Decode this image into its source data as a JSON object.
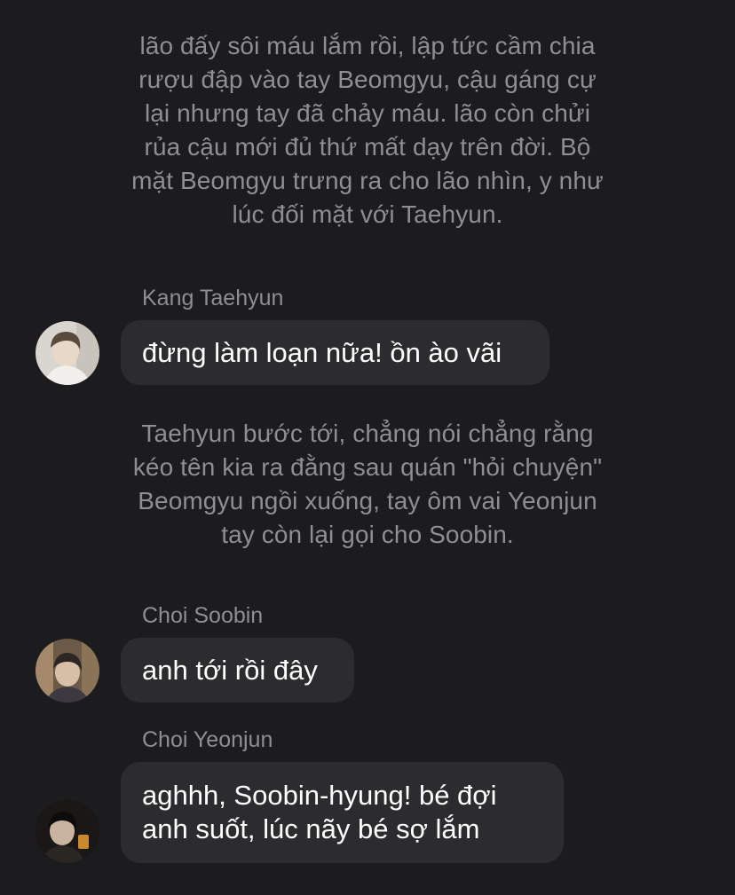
{
  "narrations": [
    {
      "lines": [
        "lão đấy sôi máu lắm rồi, lập tức cầm chia",
        "rượu đập vào tay Beomgyu, cậu gáng cự",
        "lại nhưng tay đã chảy máu. lão còn chửi",
        "rủa cậu mới đủ thứ mất dạy trên đời. Bộ",
        "mặt Beomgyu trưng ra cho lão nhìn, y như",
        "lúc đối mặt với Taehyun."
      ]
    },
    {
      "lines": [
        "Taehyun bước tới, chẳng nói chẳng rằng",
        "kéo tên kia ra đằng sau quán \"hỏi chuyện\"",
        "Beomgyu ngồi xuống, tay ôm vai Yeonjun",
        "tay còn lại gọi cho Soobin."
      ]
    }
  ],
  "messages": [
    {
      "sender": "Kang Taehyun",
      "lines": [
        "đừng làm loạn nữa! ồn ào vãi"
      ],
      "avatar_icon": "user-avatar-taehyun"
    },
    {
      "sender": "Choi Soobin",
      "lines": [
        "anh tới rồi đây"
      ],
      "avatar_icon": "user-avatar-soobin"
    },
    {
      "sender": "Choi Yeonjun",
      "lines": [
        "aghhh, Soobin-hyung! bé đợi",
        "anh suốt, lúc nãy bé sợ lắm"
      ],
      "avatar_icon": "user-avatar-yeonjun"
    }
  ],
  "colors": {
    "background": "#1c1c1e",
    "bubble": "#2c2c2e",
    "narration_text": "#8e8e93",
    "sender_text": "#8e8e93",
    "message_text": "#ffffff"
  }
}
